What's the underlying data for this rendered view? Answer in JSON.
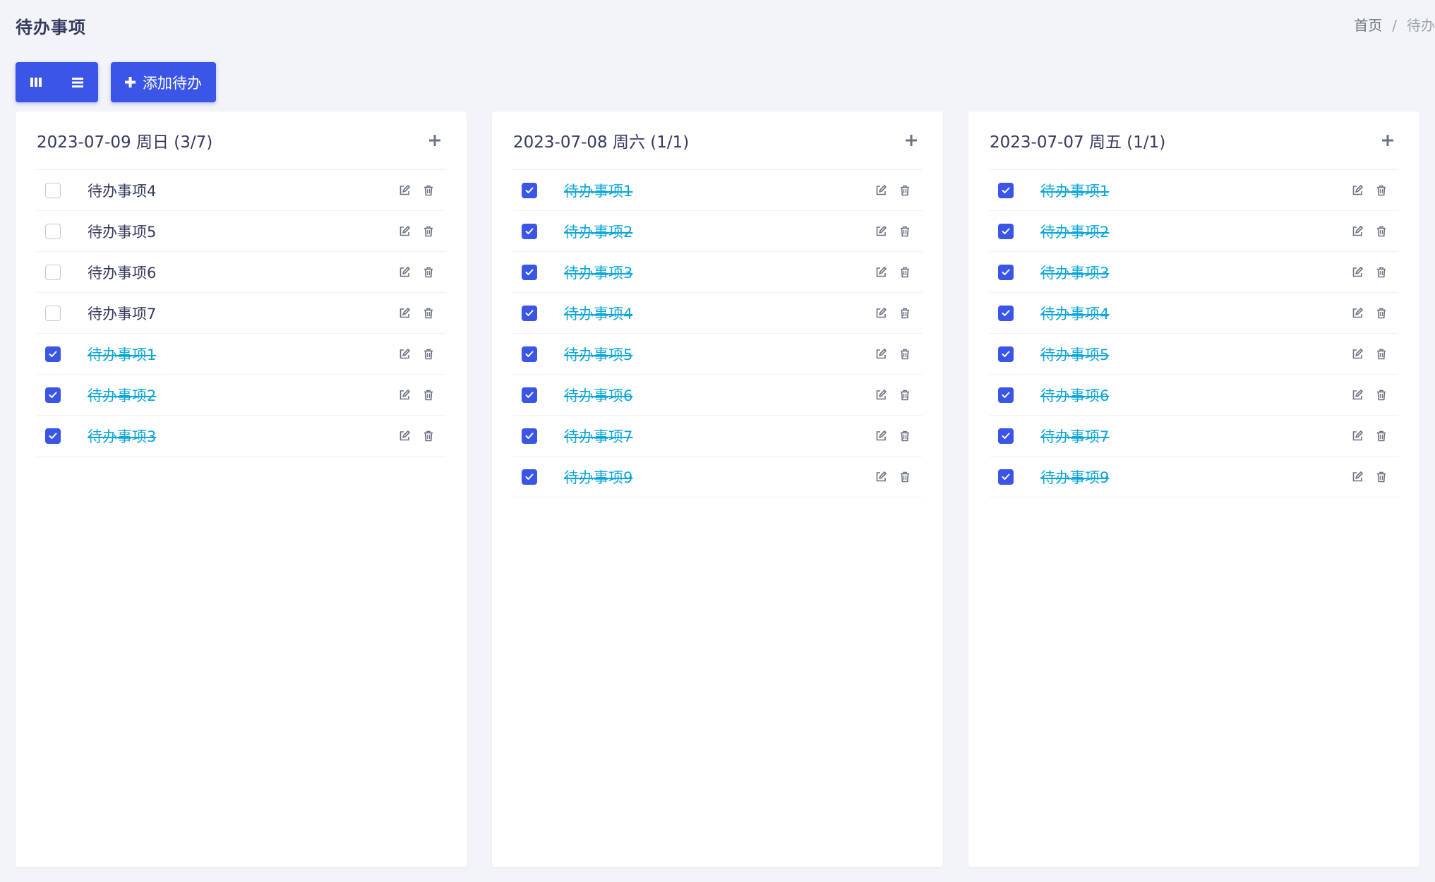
{
  "page": {
    "title": "待办事项"
  },
  "breadcrumb": {
    "home": "首页",
    "separator": "/",
    "current": "待办"
  },
  "toolbar": {
    "add_label": "添加待办"
  },
  "colors": {
    "accent": "#3b55e6",
    "done_text": "#0ba5d8",
    "text": "#34395e",
    "icon": "#6777ef"
  },
  "columns": [
    {
      "title": "2023-07-09 周日 (3/7)",
      "items": [
        {
          "text": "待办事项4",
          "done": false
        },
        {
          "text": "待办事项5",
          "done": false
        },
        {
          "text": "待办事项6",
          "done": false
        },
        {
          "text": "待办事项7",
          "done": false
        },
        {
          "text": "待办事项1",
          "done": true
        },
        {
          "text": "待办事项2",
          "done": true
        },
        {
          "text": "待办事项3",
          "done": true
        }
      ]
    },
    {
      "title": "2023-07-08 周六 (1/1)",
      "items": [
        {
          "text": "待办事项1",
          "done": true
        },
        {
          "text": "待办事项2",
          "done": true
        },
        {
          "text": "待办事项3",
          "done": true
        },
        {
          "text": "待办事项4",
          "done": true
        },
        {
          "text": "待办事项5",
          "done": true
        },
        {
          "text": "待办事项6",
          "done": true
        },
        {
          "text": "待办事项7",
          "done": true
        },
        {
          "text": "待办事项9",
          "done": true
        }
      ]
    },
    {
      "title": "2023-07-07 周五 (1/1)",
      "items": [
        {
          "text": "待办事项1",
          "done": true
        },
        {
          "text": "待办事项2",
          "done": true
        },
        {
          "text": "待办事项3",
          "done": true
        },
        {
          "text": "待办事项4",
          "done": true
        },
        {
          "text": "待办事项5",
          "done": true
        },
        {
          "text": "待办事项6",
          "done": true
        },
        {
          "text": "待办事项7",
          "done": true
        },
        {
          "text": "待办事项9",
          "done": true
        }
      ]
    }
  ]
}
